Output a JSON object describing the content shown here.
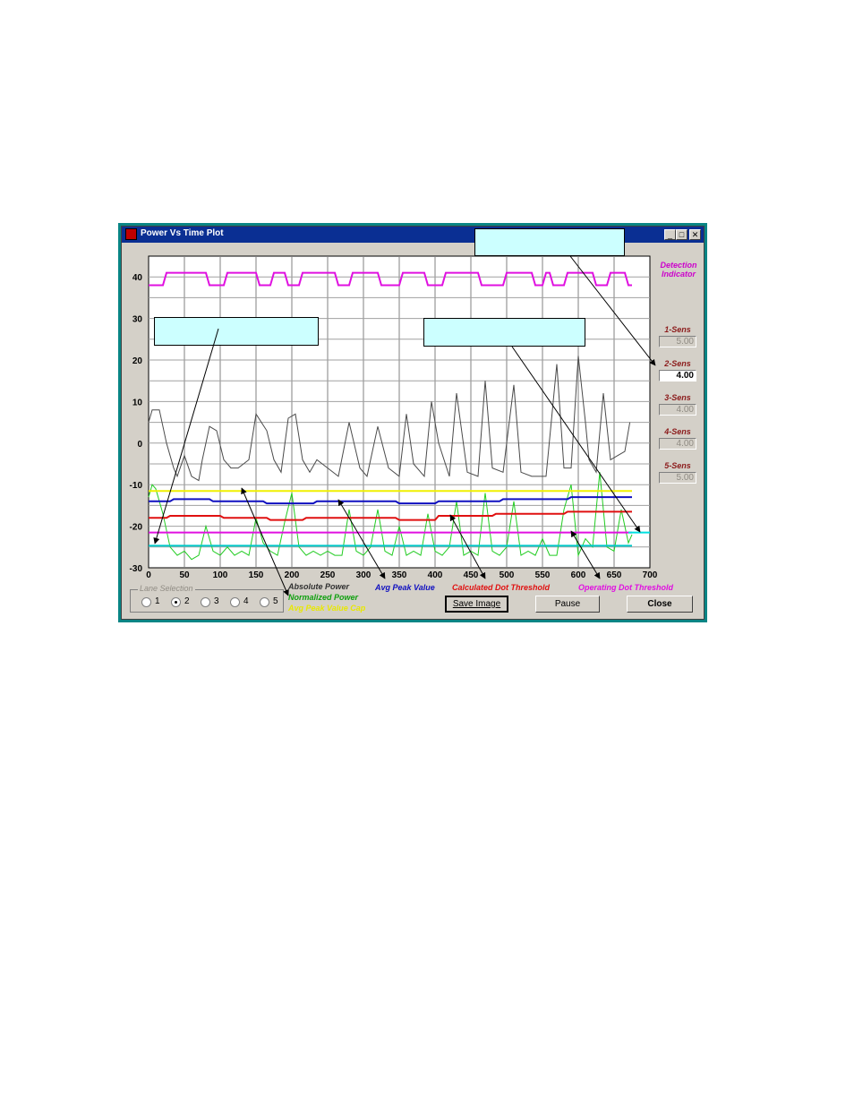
{
  "window": {
    "title": "Power Vs Time Plot",
    "minimize_label": "_",
    "maximize_label": "□",
    "close_label": "✕"
  },
  "chart_data": {
    "type": "line",
    "xlim": [
      0,
      700
    ],
    "ylim": [
      -30,
      45
    ],
    "x_ticks": [
      "0",
      "50",
      "100",
      "150",
      "200",
      "250",
      "300",
      "350",
      "400",
      "450",
      "500",
      "550",
      "600",
      "650",
      "700"
    ],
    "y_ticks": [
      "40",
      "30",
      "20",
      "10",
      "0",
      "-10",
      "-20",
      "-30"
    ],
    "grid": true,
    "series": [
      {
        "name": "Absolute Power",
        "color": "#4a4a4a",
        "x": [
          0,
          5,
          15,
          25,
          35,
          40,
          50,
          60,
          70,
          75,
          85,
          95,
          105,
          115,
          125,
          140,
          150,
          165,
          175,
          185,
          195,
          205,
          215,
          225,
          235,
          250,
          265,
          280,
          295,
          305,
          320,
          335,
          350,
          360,
          370,
          385,
          395,
          405,
          420,
          430,
          445,
          460,
          470,
          480,
          495,
          510,
          520,
          535,
          555,
          570,
          580,
          590,
          600,
          610,
          615,
          625,
          635,
          645,
          655,
          665,
          672
        ],
        "y": [
          5,
          8,
          8,
          0,
          -6,
          -8,
          -3,
          -8,
          -9,
          -4,
          4,
          3,
          -4,
          -6,
          -6,
          -4,
          7,
          3,
          -4,
          -7,
          6,
          7,
          -4,
          -7,
          -4,
          -6,
          -8,
          5,
          -6,
          -8,
          4,
          -6,
          -8,
          7,
          -5,
          -8,
          10,
          0,
          -8,
          12,
          -7,
          -8,
          15,
          -6,
          -7,
          14,
          -7,
          -8,
          -8,
          19,
          -6,
          -6,
          21,
          5,
          -4,
          -7,
          12,
          -4,
          -3,
          -2,
          5
        ]
      },
      {
        "name": "Normalized Power",
        "color": "#22cc22",
        "x": [
          0,
          5,
          10,
          20,
          30,
          40,
          50,
          60,
          70,
          80,
          90,
          100,
          110,
          120,
          130,
          140,
          150,
          160,
          170,
          180,
          190,
          200,
          210,
          220,
          230,
          240,
          250,
          260,
          270,
          280,
          290,
          300,
          310,
          320,
          330,
          340,
          350,
          360,
          370,
          380,
          390,
          400,
          410,
          420,
          430,
          440,
          450,
          460,
          470,
          480,
          490,
          500,
          510,
          520,
          530,
          540,
          550,
          560,
          570,
          580,
          590,
          600,
          610,
          620,
          630,
          640,
          650,
          660,
          670,
          675
        ],
        "y": [
          -13,
          -10,
          -11,
          -17,
          -25,
          -27,
          -26,
          -28,
          -27,
          -20,
          -26,
          -27,
          -25,
          -27,
          -26,
          -27,
          -18,
          -24,
          -26,
          -27,
          -19,
          -12,
          -25,
          -27,
          -26,
          -27,
          -26,
          -27,
          -27,
          -16,
          -26,
          -27,
          -25,
          -16,
          -26,
          -27,
          -20,
          -27,
          -26,
          -27,
          -17,
          -26,
          -27,
          -25,
          -14,
          -27,
          -26,
          -27,
          -12,
          -26,
          -27,
          -25,
          -14,
          -27,
          -26,
          -27,
          -23,
          -27,
          -27,
          -16,
          -10,
          -27,
          -23,
          -25,
          -7,
          -25,
          -26,
          -16,
          -24,
          -22
        ]
      },
      {
        "name": "Avg Peak Value Cap",
        "color": "#f0f000",
        "x": [
          0,
          675
        ],
        "y": [
          -11.5,
          -11.5
        ]
      },
      {
        "name": "Avg Peak Value",
        "color": "#1010c0",
        "x": [
          0,
          30,
          35,
          85,
          90,
          160,
          165,
          230,
          235,
          345,
          350,
          400,
          405,
          490,
          495,
          585,
          590,
          675
        ],
        "y": [
          -14,
          -14,
          -13.5,
          -13.5,
          -14,
          -14,
          -14.5,
          -14.5,
          -14,
          -14,
          -14.5,
          -14.5,
          -14,
          -14,
          -13.5,
          -13.5,
          -13,
          -13
        ],
        "step": true
      },
      {
        "name": "Calculated Dot Threshold",
        "color": "#e01010",
        "x": [
          0,
          25,
          30,
          100,
          105,
          165,
          170,
          215,
          220,
          345,
          350,
          400,
          405,
          480,
          485,
          580,
          585,
          675
        ],
        "y": [
          -18,
          -18,
          -17.5,
          -17.5,
          -18,
          -18,
          -18.5,
          -18.5,
          -18,
          -18,
          -18.5,
          -18.5,
          -17.5,
          -17.5,
          -17,
          -17,
          -16.5,
          -16.5
        ],
        "step": true
      },
      {
        "name": "Operating Dot Threshold",
        "color": "#e010e0",
        "x": [
          0,
          675
        ],
        "y": [
          -21.5,
          -21.5
        ]
      },
      {
        "name": "",
        "color": "#00c8c8",
        "x": [
          0,
          675
        ],
        "y": [
          -24.7,
          -24.7
        ]
      },
      {
        "name": "",
        "color": "#00e0e0",
        "x": [
          670,
          700
        ],
        "y": [
          -21.5,
          -21.5
        ]
      },
      {
        "name": "Detection Indicator",
        "color": "#e010e0",
        "x": [
          0,
          20,
          25,
          80,
          85,
          105,
          110,
          150,
          155,
          170,
          175,
          190,
          195,
          210,
          215,
          260,
          265,
          280,
          285,
          320,
          325,
          350,
          355,
          385,
          390,
          410,
          415,
          460,
          465,
          495,
          500,
          535,
          540,
          550,
          555,
          560,
          565,
          580,
          585,
          620,
          625,
          640,
          645,
          665,
          670,
          675
        ],
        "y": [
          38,
          38,
          41,
          41,
          38,
          38,
          41,
          41,
          38,
          38,
          41,
          41,
          38,
          38,
          41,
          41,
          38,
          38,
          41,
          41,
          38,
          38,
          41,
          41,
          38,
          38,
          41,
          41,
          38,
          38,
          41,
          41,
          38,
          38,
          41,
          41,
          38,
          38,
          41,
          41,
          38,
          38,
          41,
          41,
          38,
          38
        ],
        "step": true
      }
    ]
  },
  "side": {
    "detection_indicator": "Detection Indicator",
    "sensors": [
      {
        "label": "1-Sens",
        "value": "5.00",
        "enabled": false
      },
      {
        "label": "2-Sens",
        "value": "4.00",
        "enabled": true
      },
      {
        "label": "3-Sens",
        "value": "4.00",
        "enabled": false
      },
      {
        "label": "4-Sens",
        "value": "4.00",
        "enabled": false
      },
      {
        "label": "5-Sens",
        "value": "5.00",
        "enabled": false
      }
    ]
  },
  "lane_selection": {
    "title": "Lane Selection",
    "options": [
      "1",
      "2",
      "3",
      "4",
      "5"
    ],
    "selected": "2"
  },
  "legend": {
    "absolute_power": "Absolute Power",
    "normalized_power": "Normalized Power",
    "avg_peak_value_cap": "Avg Peak Value Cap",
    "avg_peak_value": "Avg Peak Value",
    "calculated_dot_threshold": "Calculated Dot Threshold",
    "operating_dot_threshold": "Operating Dot Threshold"
  },
  "buttons": {
    "save_image": "Save Image",
    "pause": "Pause",
    "close": "Close"
  },
  "colors": {
    "frame": "#098585",
    "window_bg": "#d4d0c8",
    "titlebar": "#0a2f93",
    "callout_fill": "#ccffff"
  }
}
